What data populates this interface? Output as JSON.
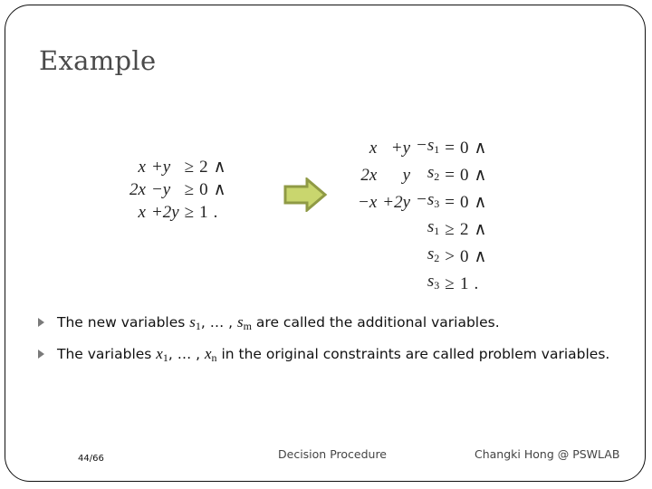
{
  "slide": {
    "title": "Example",
    "left_system": {
      "rows": [
        {
          "c1": "x",
          "c2": "+y",
          "rel": "≥",
          "rhs": "2",
          "end": "∧"
        },
        {
          "c1": "2x",
          "c2": "−y",
          "rel": "≥",
          "rhs": "0",
          "end": "∧"
        },
        {
          "c1": "x",
          "c2": "+2y",
          "rel": "≥",
          "rhs": "1",
          "end": "."
        }
      ]
    },
    "right_system": {
      "rows": [
        {
          "c1": "x",
          "c2": "+y",
          "c3": "−s",
          "sub": "1",
          "rel": "=",
          "rhs": "0",
          "end": "∧"
        },
        {
          "c1": "2x",
          "c2": "y",
          "c3": "s",
          "sub": "2",
          "rel": "=",
          "rhs": "0",
          "end": "∧"
        },
        {
          "c1": "−x",
          "c2": "+2y",
          "c3": "−s",
          "sub": "3",
          "rel": "=",
          "rhs": "0",
          "end": "∧"
        },
        {
          "c1": "",
          "c2": "",
          "c3": "s",
          "sub": "1",
          "rel": "≥",
          "rhs": "2",
          "end": "∧"
        },
        {
          "c1": "",
          "c2": "",
          "c3": "s",
          "sub": "2",
          "rel": ">",
          "rhs": "0",
          "end": "∧"
        },
        {
          "c1": "",
          "c2": "",
          "c3": "s",
          "sub": "3",
          "rel": "≥",
          "rhs": "1",
          "end": "."
        }
      ]
    },
    "arrow": {
      "fill": "#c9d66e",
      "stroke": "#8f9a45"
    },
    "bullets": [
      {
        "pre": "The new variables ",
        "v1": "s",
        "s1": "1",
        "mid": ", … , ",
        "v2": "s",
        "s2": "m",
        "post": " are called the additional variables."
      },
      {
        "pre": "The variables ",
        "v1": "x",
        "s1": "1",
        "mid": ", … , ",
        "v2": "x",
        "s2": "n",
        "post": " in the original constraints are called problem variables."
      }
    ]
  },
  "footer": {
    "page": "44/66",
    "center": "Decision Procedure",
    "right": "Changki Hong @ PSWLAB"
  }
}
